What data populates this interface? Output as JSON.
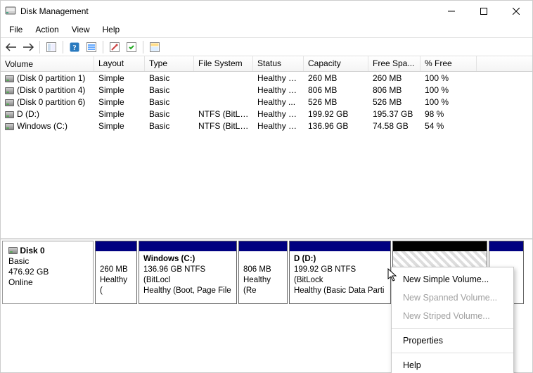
{
  "title": "Disk Management",
  "menu": {
    "file": "File",
    "action": "Action",
    "view": "View",
    "help": "Help"
  },
  "columns": {
    "volume": "Volume",
    "layout": "Layout",
    "type": "Type",
    "file_system": "File System",
    "status": "Status",
    "capacity": "Capacity",
    "free": "Free Spa...",
    "pct": "% Free"
  },
  "volumes": [
    {
      "name": "(Disk 0 partition 1)",
      "layout": "Simple",
      "type": "Basic",
      "fs": "",
      "status": "Healthy (E...",
      "capacity": "260 MB",
      "free": "260 MB",
      "pct": "100 %"
    },
    {
      "name": "(Disk 0 partition 4)",
      "layout": "Simple",
      "type": "Basic",
      "fs": "",
      "status": "Healthy (R...",
      "capacity": "806 MB",
      "free": "806 MB",
      "pct": "100 %"
    },
    {
      "name": "(Disk 0 partition 6)",
      "layout": "Simple",
      "type": "Basic",
      "fs": "",
      "status": "Healthy ...",
      "capacity": "526 MB",
      "free": "526 MB",
      "pct": "100 %"
    },
    {
      "name": "D (D:)",
      "layout": "Simple",
      "type": "Basic",
      "fs": "NTFS (BitLo...",
      "status": "Healthy (B...",
      "capacity": "199.92 GB",
      "free": "195.37 GB",
      "pct": "98 %"
    },
    {
      "name": "Windows (C:)",
      "layout": "Simple",
      "type": "Basic",
      "fs": "NTFS (BitLo...",
      "status": "Healthy (B...",
      "capacity": "136.96 GB",
      "free": "74.58 GB",
      "pct": "54 %"
    }
  ],
  "disk": {
    "label": "Disk 0",
    "type": "Basic",
    "size": "476.92 GB",
    "state": "Online"
  },
  "partitions": {
    "p1_line1": "260 MB",
    "p1_line2": "Healthy (",
    "p2_title": "Windows  (C:)",
    "p2_line2": "136.96 GB NTFS (BitLocl",
    "p2_line3": "Healthy (Boot, Page File",
    "p3_line1": "806 MB",
    "p3_line2": "Healthy (Re",
    "p4_title": "D  (D:)",
    "p4_line2": "199.92 GB NTFS (BitLock",
    "p4_line3": "Healthy (Basic Data Parti"
  },
  "context_menu": {
    "new_simple": "New Simple Volume...",
    "new_spanned": "New Spanned Volume...",
    "new_striped": "New Striped Volume...",
    "properties": "Properties",
    "help": "Help"
  }
}
